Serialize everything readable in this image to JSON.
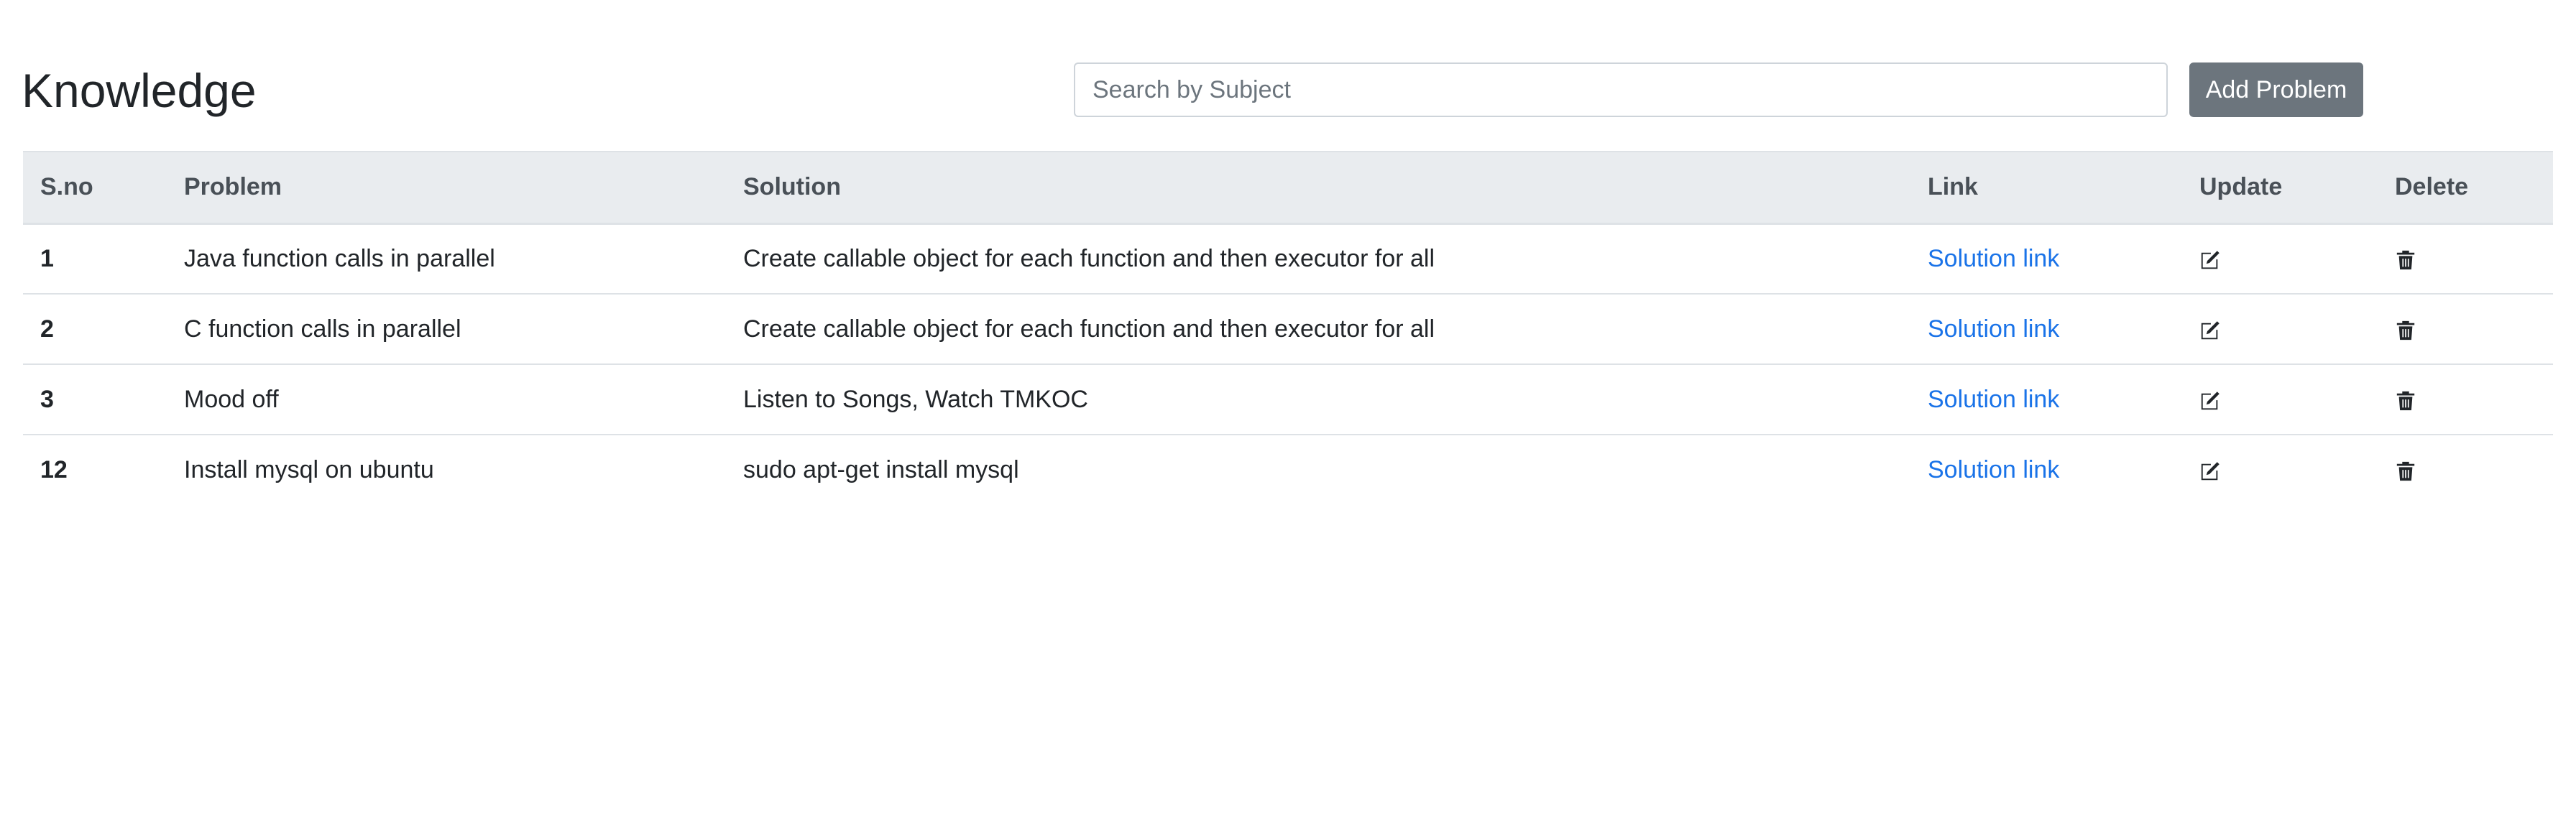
{
  "header": {
    "title": "Knowledge",
    "search_placeholder": "Search by Subject",
    "search_value": "",
    "add_button_label": "Add Problem"
  },
  "table": {
    "columns": [
      "S.no",
      "Problem",
      "Solution",
      "Link",
      "Update",
      "Delete"
    ],
    "rows": [
      {
        "sno": "1",
        "problem": "Java function calls in parallel",
        "solution": "Create callable object for each function and then executor for all",
        "link": "Solution link",
        "update_icon": "edit-icon",
        "delete_icon": "trash-icon"
      },
      {
        "sno": "2",
        "problem": "C function calls in parallel",
        "solution": "Create callable object for each function and then executor for all",
        "link": "Solution link",
        "update_icon": "edit-icon",
        "delete_icon": "trash-icon"
      },
      {
        "sno": "3",
        "problem": "Mood off",
        "solution": "Listen to Songs, Watch TMKOC",
        "link": "Solution link",
        "update_icon": "edit-icon",
        "delete_icon": "trash-icon"
      },
      {
        "sno": "12",
        "problem": "Install mysql on ubuntu",
        "solution": "sudo apt-get install mysql",
        "link": "Solution link",
        "update_icon": "edit-icon",
        "delete_icon": "trash-icon"
      }
    ]
  },
  "colors": {
    "button_bg": "#6c757d",
    "header_bg": "#e9ecef",
    "link": "#1a73e8",
    "text": "#212529"
  }
}
